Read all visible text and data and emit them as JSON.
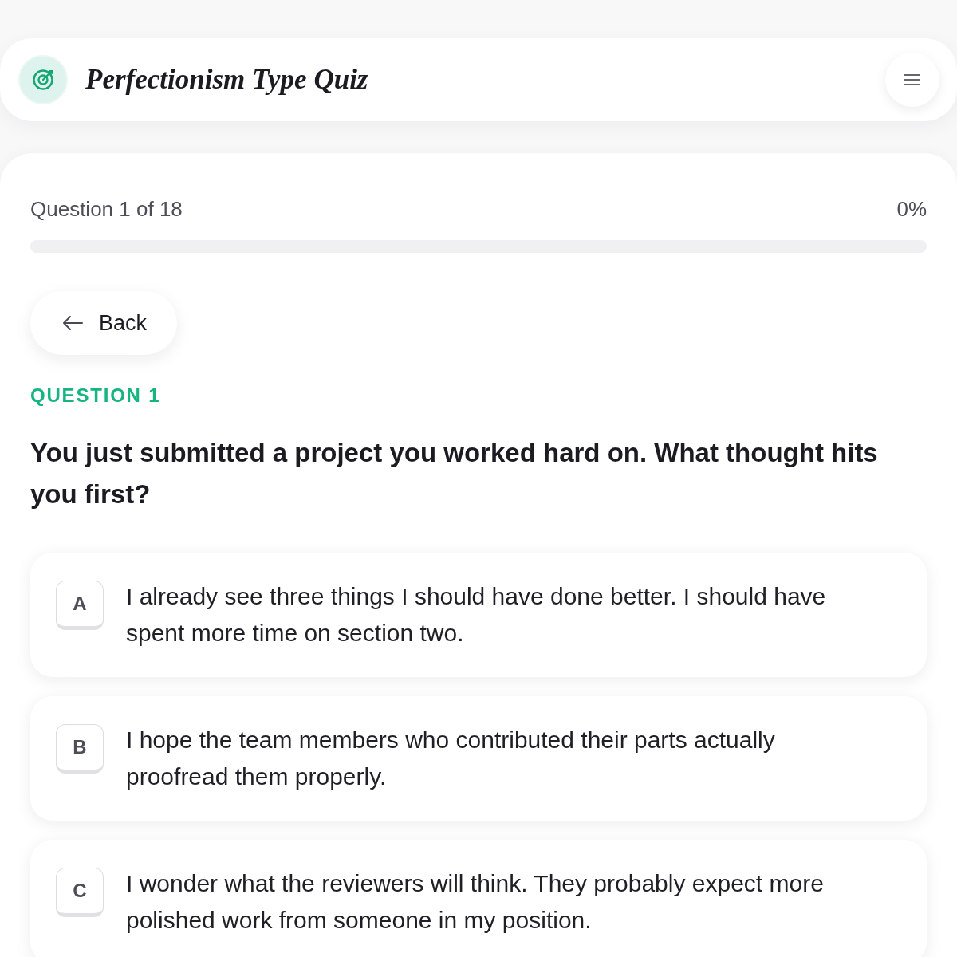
{
  "header": {
    "title": "Perfectionism Type Quiz"
  },
  "progress": {
    "label": "Question 1 of 18",
    "percent": "0%",
    "level": 0
  },
  "back_button": {
    "label": "Back"
  },
  "question": {
    "eyebrow": "QUESTION 1",
    "text": "You just submitted a project you worked hard on. What thought hits you first?"
  },
  "options": [
    {
      "letter": "A",
      "text": "I already see three things I should have done better. I should have spent more time on section two.",
      "selected": false
    },
    {
      "letter": "B",
      "text": "I hope the team members who contributed their parts actually proofread them properly.",
      "selected": false
    },
    {
      "letter": "C",
      "text": "I wonder what the reviewers will think. They probably expect more polished work from someone in my position.",
      "selected": false
    }
  ]
}
